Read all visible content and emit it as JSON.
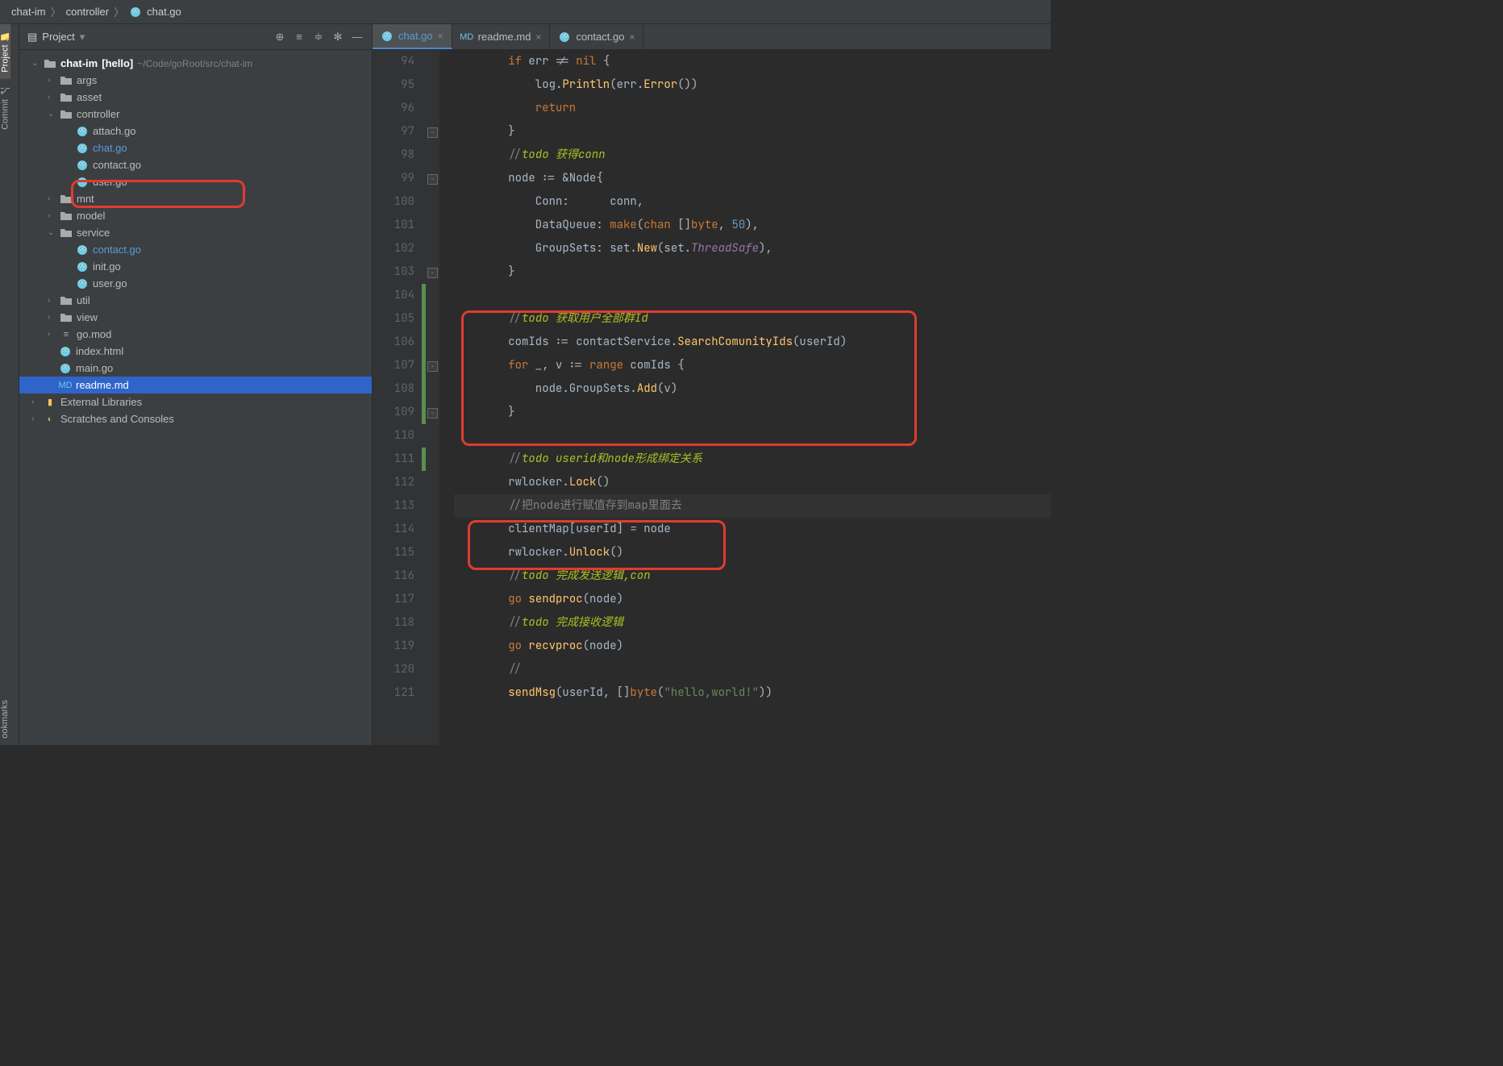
{
  "breadcrumb": {
    "p0": "chat-im",
    "p1": "controller",
    "p2": "chat.go"
  },
  "sidebar": {
    "title": "Project",
    "root_label": "chat-im",
    "root_hint": "[hello]",
    "root_path": "~/Code/goRoot/src/chat-im",
    "items": {
      "args": "args",
      "asset": "asset",
      "controller": "controller",
      "attach_go": "attach.go",
      "chat_go": "chat.go",
      "contact_go": "contact.go",
      "user_go": "user.go",
      "mnt": "mnt",
      "model": "model",
      "service": "service",
      "s_contact_go": "contact.go",
      "s_init_go": "init.go",
      "s_user_go": "user.go",
      "util": "util",
      "view": "view",
      "go_mod": "go.mod",
      "index_html": "index.html",
      "main_go": "main.go",
      "readme_md": "readme.md",
      "ext_lib": "External Libraries",
      "scratches": "Scratches and Consoles"
    }
  },
  "tabs": {
    "t0": "chat.go",
    "t1": "readme.md",
    "t2": "contact.go"
  },
  "code_lines": [
    {
      "n": 94,
      "html": "<span class='kw'>if</span> err != <span class='kw'>nil</span> {"
    },
    {
      "n": 95,
      "html": "    log.<span class='fn'>Println</span>(err.<span class='fn'>Error</span>())"
    },
    {
      "n": 96,
      "html": "    <span class='kw'>return</span>"
    },
    {
      "n": 97,
      "html": "}"
    },
    {
      "n": 98,
      "html": "<span class='comment'>//</span><span class='todo'>todo 获得conn</span>"
    },
    {
      "n": 99,
      "html": "node := &amp;Node{"
    },
    {
      "n": 100,
      "html": "    Conn:      conn,"
    },
    {
      "n": 101,
      "html": "    DataQueue: <span class='builtin'>make</span>(<span class='kw'>chan</span> []<span class='kw'>byte</span>, <span class='num'>50</span>),"
    },
    {
      "n": 102,
      "html": "    GroupSets: set.<span class='fn'>New</span>(set.<span class='ital'>ThreadSafe</span>),"
    },
    {
      "n": 103,
      "html": "}"
    },
    {
      "n": 104,
      "html": ""
    },
    {
      "n": 105,
      "html": "<span class='comment'>//</span><span class='todo'>todo 获取用户全部群Id</span>"
    },
    {
      "n": 106,
      "html": "comIds := contactService.<span class='fn'>SearchComunityIds</span>(userId)"
    },
    {
      "n": 107,
      "html": "<span class='kw'>for</span> _, v := <span class='kw'>range</span> comIds {"
    },
    {
      "n": 108,
      "html": "    node.GroupSets.<span class='fn'>Add</span>(v)"
    },
    {
      "n": 109,
      "html": "}"
    },
    {
      "n": 110,
      "html": ""
    },
    {
      "n": 111,
      "html": "<span class='comment'>//</span><span class='todo'>todo userid和node形成绑定关系</span>"
    },
    {
      "n": 112,
      "html": "rwlocker.<span class='fn'>Lock</span>()"
    },
    {
      "n": 113,
      "html": "<span class='comment'>//把node进行赋值存到map里面去</span>",
      "current": true
    },
    {
      "n": 114,
      "html": "clientMap[userId] = node"
    },
    {
      "n": 115,
      "html": "rwlocker.<span class='fn'>Unlock</span>()"
    },
    {
      "n": 116,
      "html": "<span class='comment'>//</span><span class='todo'>todo 完成发送逻辑,con</span>"
    },
    {
      "n": 117,
      "html": "<span class='kw'>go</span> <span class='fn'>sendproc</span>(node)"
    },
    {
      "n": 118,
      "html": "<span class='comment'>//</span><span class='todo'>todo 完成接收逻辑</span>"
    },
    {
      "n": 119,
      "html": "<span class='kw'>go</span> <span class='fn'>recvproc</span>(node)"
    },
    {
      "n": 120,
      "html": "<span class='comment'>//</span>"
    },
    {
      "n": 121,
      "html": "<span class='fn'>sendMsg</span>(userId, []<span class='kw'>byte</span>(<span class='str'>\"hello,world!\"</span>))"
    }
  ],
  "rail": {
    "project": "Project",
    "commit": "Commit",
    "bookmarks": "ookmarks"
  }
}
